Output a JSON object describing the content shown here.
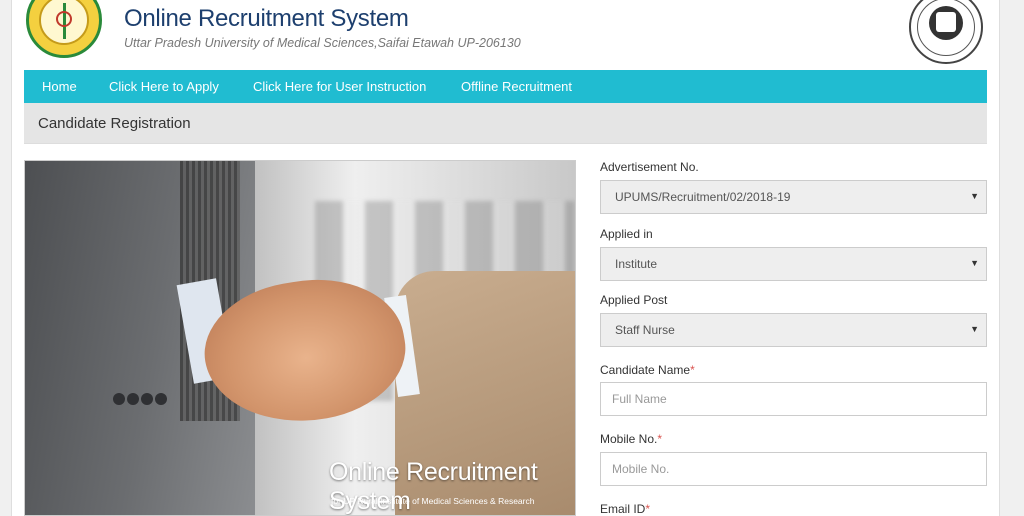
{
  "header": {
    "title": "Online Recruitment System",
    "subtitle": "Uttar Pradesh University of Medical Sciences,Saifai Etawah UP-206130"
  },
  "nav": {
    "items": [
      {
        "label": "Home"
      },
      {
        "label": "Click Here to Apply"
      },
      {
        "label": "Click Here for User Instruction"
      },
      {
        "label": "Offline Recruitment"
      }
    ]
  },
  "breadcrumb": {
    "label": "Candidate Registration"
  },
  "hero": {
    "title": "Online Recruitment System",
    "subtitle": "for UP Rural Institute of Medical Sciences & Research"
  },
  "form": {
    "advertisement": {
      "label": "Advertisement No.",
      "value": "UPUMS/Recruitment/02/2018-19"
    },
    "applied_in": {
      "label": "Applied in",
      "value": "Institute"
    },
    "applied_post": {
      "label": "Applied Post",
      "value": "Staff Nurse"
    },
    "candidate_name": {
      "label": "Candidate Name",
      "required": "*",
      "placeholder": "Full Name"
    },
    "mobile": {
      "label": "Mobile No.",
      "required": "*",
      "placeholder": "Mobile No."
    },
    "email": {
      "label": "Email ID",
      "required": "*"
    }
  },
  "colors": {
    "nav_bg": "#20bcd1",
    "title": "#1d3f6e",
    "required": "#d9534f"
  },
  "icons": {
    "left_logo": "university-emblem-icon",
    "right_logo": "up-government-seal-icon",
    "select_caret": "caret-down-icon"
  }
}
